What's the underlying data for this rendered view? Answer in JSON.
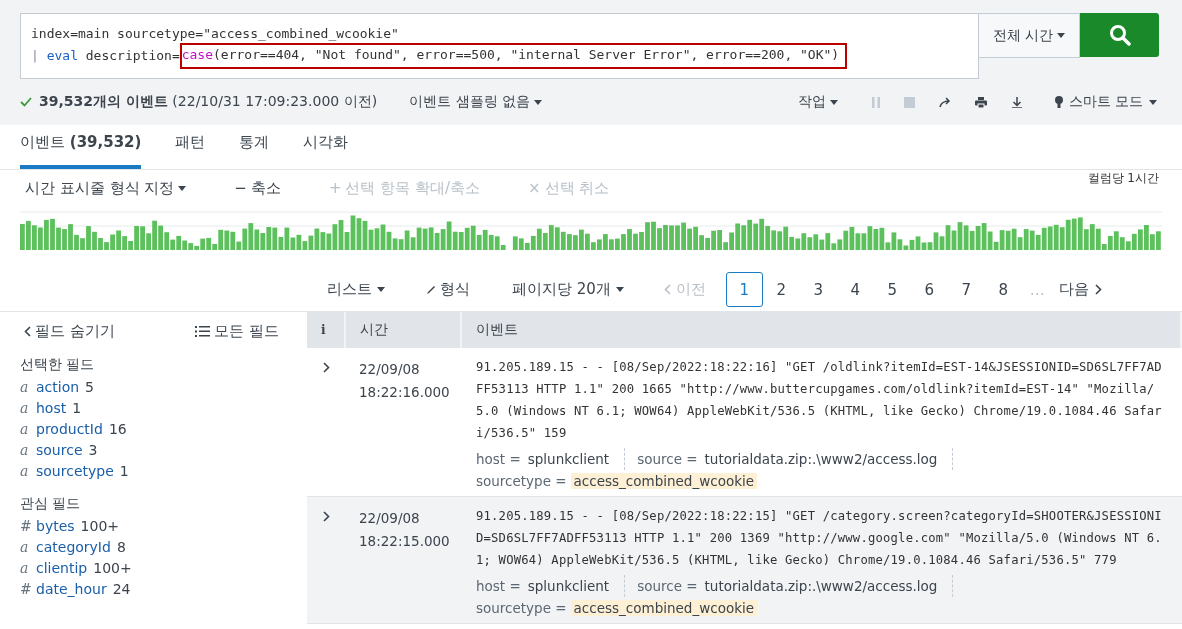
{
  "search": {
    "query_lines": [
      [
        {
          "text": "index=main sourcetype=\"access_combined_wcookie\"",
          "kind": "plain"
        }
      ],
      [
        {
          "text": "| ",
          "kind": "pipe"
        },
        {
          "text": "eval",
          "kind": "command"
        },
        {
          "text": " description=",
          "kind": "plain"
        },
        {
          "text": "case",
          "kind": "function",
          "boxed": true
        },
        {
          "text": "(error==404, \"Not found\", error==500, \"internal Server Error\", error==200, \"OK\")",
          "kind": "plain",
          "boxed": true
        }
      ]
    ],
    "time_range": "전체 시간"
  },
  "job_bar": {
    "status": "**39,532개의 이벤트** (22/10/31 17:09:23.000 이전)",
    "done": true,
    "sampling": "이벤트 샘플링 없음",
    "actions": "작업",
    "pause_disabled": true,
    "stop_disabled": true,
    "mode": "스마트 모드"
  },
  "tabs": [
    {
      "label": "이벤트 **(39,532)**",
      "selected": true
    },
    {
      "label": "패턴",
      "selected": false
    },
    {
      "label": "통계",
      "selected": false
    },
    {
      "label": "시각화",
      "selected": false
    }
  ],
  "timeline": {
    "controls": [
      {
        "label": "시간 표시줄 형식 지정",
        "caret": true,
        "disabled": false
      },
      {
        "icon": "−",
        "label": "축소",
        "caret": false,
        "disabled": false
      },
      {
        "icon": "+",
        "label": "선택 항목 확대/축소",
        "caret": false,
        "disabled": true
      },
      {
        "icon": "×",
        "label": "선택 취소",
        "caret": false,
        "disabled": true
      }
    ],
    "scale": "컬럼당 1시간"
  },
  "results_bar": {
    "view": "리스트",
    "format": "형식",
    "per_page": "페이지당 20개",
    "prev": {
      "label": "이전",
      "disabled": true
    },
    "pages": [
      {
        "label": "1",
        "selected": true
      },
      {
        "label": "2",
        "selected": false
      },
      {
        "label": "3",
        "selected": false
      },
      {
        "label": "4",
        "selected": false
      },
      {
        "label": "5",
        "selected": false
      },
      {
        "label": "6",
        "selected": false
      },
      {
        "label": "7",
        "selected": false
      },
      {
        "label": "8",
        "selected": false
      }
    ],
    "ellipsis": "…",
    "next": "다음"
  },
  "sidebar": {
    "hide": "필드 숨기기",
    "all_fields": "모든 필드",
    "sections": [
      {
        "title": "선택한 필드",
        "fields": [
          {
            "type": "a",
            "name": "action",
            "count": "5"
          },
          {
            "type": "a",
            "name": "host",
            "count": "1"
          },
          {
            "type": "a",
            "name": "productId",
            "count": "16"
          },
          {
            "type": "a",
            "name": "source",
            "count": "3"
          },
          {
            "type": "a",
            "name": "sourcetype",
            "count": "1"
          }
        ]
      },
      {
        "title": "관심 필드",
        "fields": [
          {
            "type": "#",
            "name": "bytes",
            "count": "100+"
          },
          {
            "type": "a",
            "name": "categoryId",
            "count": "8"
          },
          {
            "type": "a",
            "name": "clientip",
            "count": "100+"
          },
          {
            "type": "#",
            "name": "date_hour",
            "count": "24"
          }
        ]
      }
    ]
  },
  "table": {
    "columns": [
      "i",
      "시간",
      "이벤트"
    ],
    "rows": [
      {
        "hovered": false,
        "date": "22/09/08",
        "clock": "18:22:16.000",
        "raw": "91.205.189.15 - - [08/Sep/2022:18:22:16] \"GET /oldlink?itemId=EST-14&JSESSIONID=SD6SL7FF7ADFF53113 HTTP 1.1\" 200 1665 \"http://www.buttercupgames.com/oldlink?itemId=EST-14\" \"Mozilla/5.0 (Windows NT 6.1; WOW64) AppleWebKit/536.5 (KHTML, like Gecko) Chrome/19.0.1084.46 Safari/536.5\" 159",
        "fields": [
          {
            "key": "host =",
            "value": "splunkclient",
            "highlighted": false
          },
          {
            "key": "source =",
            "value": "tutorialdata.zip:.\\www2/access.log",
            "highlighted": false
          },
          {
            "key": "sourcetype =",
            "value": "access_combined_wcookie",
            "highlighted": true
          }
        ]
      },
      {
        "hovered": true,
        "date": "22/09/08",
        "clock": "18:22:15.000",
        "raw": "91.205.189.15 - - [08/Sep/2022:18:22:15] \"GET /category.screen?categoryId=SHOOTER&JSESSIONID=SD6SL7FF7ADFF53113 HTTP 1.1\" 200 1369 \"http://www.google.com\" \"Mozilla/5.0 (Windows NT 6.1; WOW64) AppleWebKit/536.5 (KHTML, like Gecko) Chrome/19.0.1084.46 Safari/536.5\" 779",
        "fields": [
          {
            "key": "host =",
            "value": "splunkclient",
            "highlighted": false
          },
          {
            "key": "source =",
            "value": "tutorialdata.zip:.\\www2/access.log",
            "highlighted": false
          },
          {
            "key": "sourcetype =",
            "value": "access_combined_wcookie",
            "highlighted": true
          }
        ]
      }
    ]
  }
}
